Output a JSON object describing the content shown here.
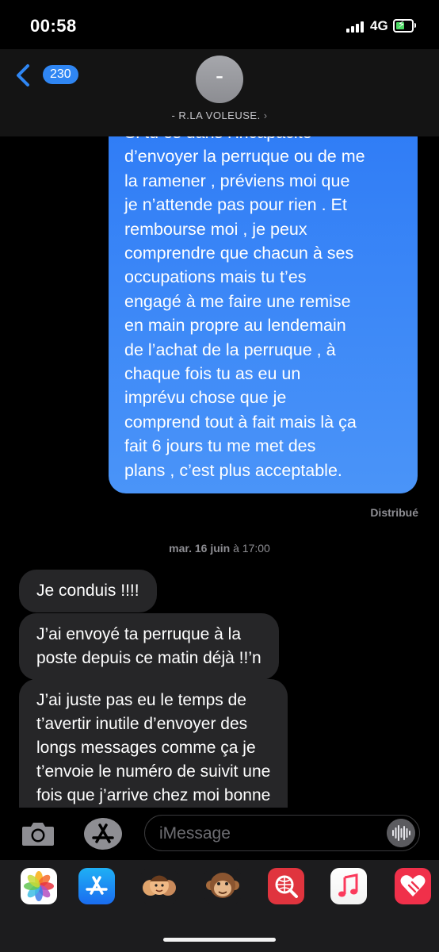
{
  "status_bar": {
    "time": "00:58",
    "network": "4G"
  },
  "header": {
    "back_count": "230",
    "avatar_letter": "-",
    "contact_name": "- R.LA VOLEUSE.",
    "chevron": "›"
  },
  "messages": {
    "outgoing": {
      "lines": [
        "Si tu es dans l’incapacité",
        "d’envoyer la perruque ou de me",
        "la ramener , préviens moi que",
        "je n’attende pas pour rien . Et",
        "rembourse moi , je peux",
        "comprendre que chacun à ses",
        "occupations mais tu t’es",
        "engagé à me faire une remise",
        "en main propre au lendemain",
        "de l’achat de la perruque , à",
        "chaque fois tu as eu un",
        "imprévu chose que je",
        "comprend tout à fait mais là ça",
        "fait 6 jours tu me met des",
        "plans , c’est plus acceptable."
      ],
      "status": "Distribué"
    },
    "timestamp": {
      "day": "mar. 16 juin",
      "time": "à 17:00"
    },
    "incoming": [
      {
        "lines": [
          "Je conduis !!!!"
        ]
      },
      {
        "lines": [
          "J’ai envoyé ta perruque à la",
          "poste depuis ce matin déjà !!’n"
        ]
      },
      {
        "lines": [
          "J’ai juste pas eu le temps de",
          "t’avertir inutile d’envoyer des",
          "longs messages comme ça je",
          "t’envoie le numéro de suivit une",
          "fois que j’arrive chez moi bonne"
        ]
      }
    ]
  },
  "input": {
    "placeholder": "iMessage"
  },
  "icons": {
    "camera": "camera-icon",
    "appstore": "app-store-icon",
    "audio": "waveform-icon",
    "drawer": [
      "photos-icon",
      "app-store-icon",
      "memoji-icon",
      "animoji-monkey-icon",
      "web-images-icon",
      "music-icon",
      "digital-touch-icon"
    ]
  },
  "colors": {
    "outgoing_bubble": "#2f7cf6",
    "incoming_bubble": "#262628",
    "badge": "#2f86f3",
    "battery_charge": "#4cd964"
  }
}
